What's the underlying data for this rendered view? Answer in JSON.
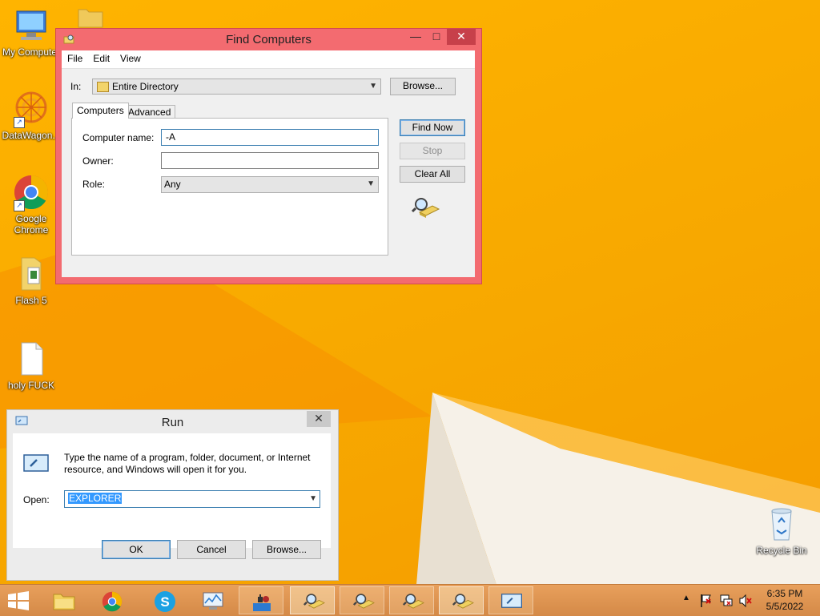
{
  "desktop": {
    "icons": [
      {
        "label": "My Computer"
      },
      {
        "label": "DataWagon..."
      },
      {
        "label": "Google Chrome"
      },
      {
        "label": "Flash 5"
      },
      {
        "label": "holy FUCK"
      },
      {
        "label": "Recycle Bin"
      }
    ]
  },
  "find_window": {
    "title": "Find Computers",
    "menu": [
      "File",
      "Edit",
      "View"
    ],
    "in_label": "In:",
    "in_value": "Entire Directory",
    "browse_label": "Browse...",
    "tabs": [
      "Computers",
      "Advanced"
    ],
    "active_tab": "Computers",
    "fields": {
      "computer_name_label": "Computer name:",
      "computer_name_value": "-A",
      "owner_label": "Owner:",
      "owner_value": "",
      "role_label": "Role:",
      "role_value": "Any"
    },
    "buttons": {
      "find_now": "Find Now",
      "stop": "Stop",
      "clear_all": "Clear All"
    },
    "caption": {
      "minimize": "—",
      "maximize": "□",
      "close": "✕"
    }
  },
  "run_window": {
    "title": "Run",
    "description": "Type the name of a program, folder, document, or Internet resource, and Windows will open it for you.",
    "open_label": "Open:",
    "open_value": "EXPLORER",
    "buttons": {
      "ok": "OK",
      "cancel": "Cancel",
      "browse": "Browse..."
    },
    "caption": {
      "close": "✕"
    }
  },
  "taskbar": {
    "clock_time": "6:35 PM",
    "clock_date": "5/5/2022",
    "tray_arrow": "▲"
  },
  "colors": {
    "desktop": "#ffb400",
    "find_frame": "#f36b70",
    "taskbar": "#dc9150",
    "selection": "#3399ff"
  }
}
